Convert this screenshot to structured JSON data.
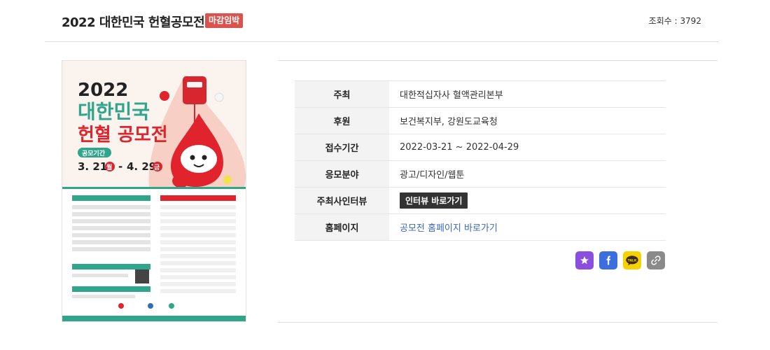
{
  "header": {
    "title": "2022 대한민국 헌혈공모전",
    "badge": "마감임박",
    "views": "조회수 : 3792"
  },
  "poster": {
    "year": "2022",
    "line1": "대한민국",
    "line2": "헌혈 공모전",
    "period_label": "공모기간",
    "period_start": "3. 21.",
    "period_start_day": "월",
    "period_end": "4. 29.",
    "period_end_day": "금"
  },
  "details": {
    "rows": [
      {
        "label": "주최",
        "value": "대한적십자사 혈액관리본부"
      },
      {
        "label": "후원",
        "value": "보건복지부, 강원도교육청"
      },
      {
        "label": "접수기간",
        "value": "2022-03-21 ~ 2022-04-29"
      },
      {
        "label": "응모분야",
        "value": "광고/디자인/웹툰"
      }
    ],
    "interview_label": "주최사인터뷰",
    "interview_button": "인터뷰 바로가기",
    "homepage_label": "홈페이지",
    "homepage_link": "공모전 홈페이지 바로가기"
  },
  "share": {
    "buttons": [
      {
        "name": "favorite",
        "icon": "star-icon",
        "color": "#8b4fe0"
      },
      {
        "name": "facebook",
        "icon": "facebook-icon",
        "color": "#3b6fe0"
      },
      {
        "name": "kakaotalk",
        "icon": "talk-icon",
        "color": "#f6d200"
      },
      {
        "name": "copy-link",
        "icon": "link-icon",
        "color": "#8a8a8a"
      }
    ]
  }
}
